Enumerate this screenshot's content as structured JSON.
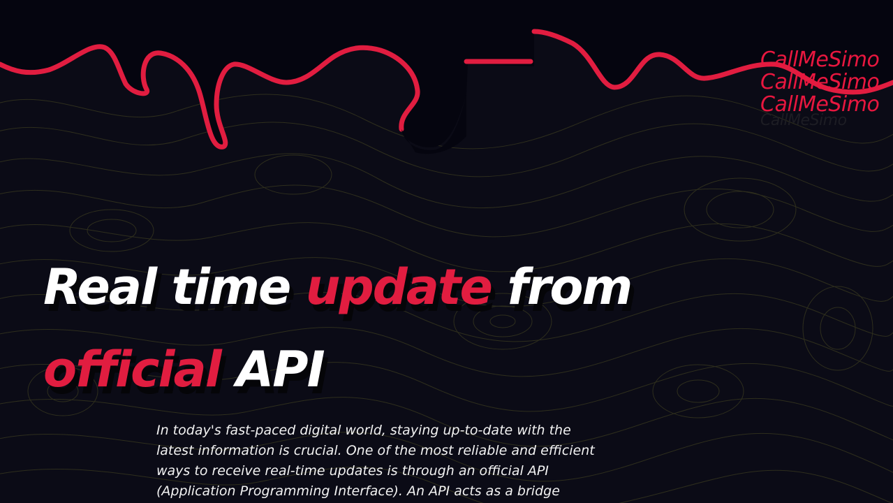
{
  "brand": {
    "repeat_text": "CallMeSimo"
  },
  "hero": {
    "line1_part1": "Real time ",
    "line1_accent": "update",
    "line1_part2": " from",
    "line2_accent": "official",
    "line2_part2": " API"
  },
  "intro": {
    "text": "In today's fast-paced digital world, staying up-to-date with the latest information is crucial. One of the most reliable and efficient ways to receive real-time updates is through an official API (Application Programming Interface). An API acts as a bridge"
  },
  "colors": {
    "background": "#0b0b16",
    "accent": "#e11d40",
    "text": "#ffffff",
    "contour": "#3a3a22"
  }
}
